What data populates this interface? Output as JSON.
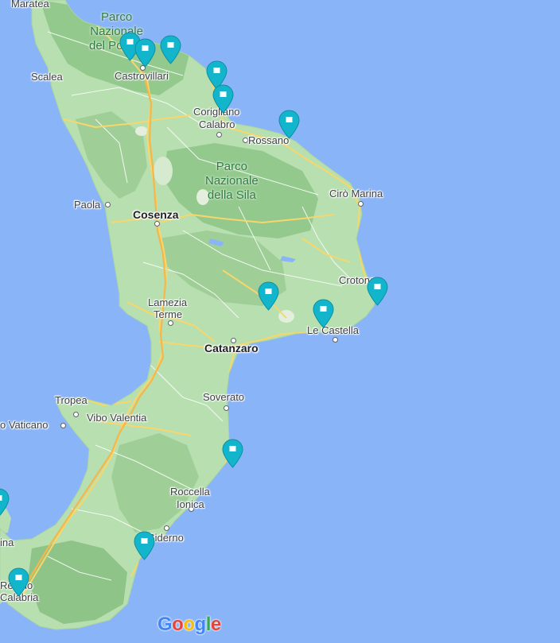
{
  "map": {
    "water_color": "#8ab4f8",
    "land_color": "#b7dfb0",
    "forest_color": "#94c98e",
    "road_color": "#f9d66b",
    "marker_color": "#12b5cb",
    "labels": {
      "maratea": "Maratea",
      "scalea": "Scalea",
      "castrovillari": "Castrovillari",
      "corigliano": "Corigliano",
      "calabro": "Calabro",
      "rossano": "Rossano",
      "paola": "Paola",
      "cosenza": "Cosenza",
      "ciro_marina": "Cirò Marina",
      "crotone": "Crotone",
      "lamezia": "Lamezia",
      "terme": "Terme",
      "le_castella": "Le Castella",
      "catanzaro": "Catanzaro",
      "soverato": "Soverato",
      "tropea": "Tropea",
      "vibo_valentia": "Vibo Valentia",
      "vaticano": "o Vaticano",
      "roccella": "Roccella",
      "ionica": "Ionica",
      "siderno": "Siderno",
      "messina_partial": "ina",
      "reggio": "Reggio",
      "calabria": "Calabria"
    },
    "parks": {
      "pollino": "Parco\nNazionale\ndel Pollino",
      "sila": "Parco\nNazionale\ndella Sila"
    },
    "markers_icon": "map-pin-icon",
    "attribution": {
      "letters": [
        "G",
        "o",
        "o",
        "g",
        "l",
        "e"
      ],
      "colors": [
        "#4285f4",
        "#ea4335",
        "#fbbc05",
        "#4285f4",
        "#34a853",
        "#ea4335"
      ]
    }
  }
}
